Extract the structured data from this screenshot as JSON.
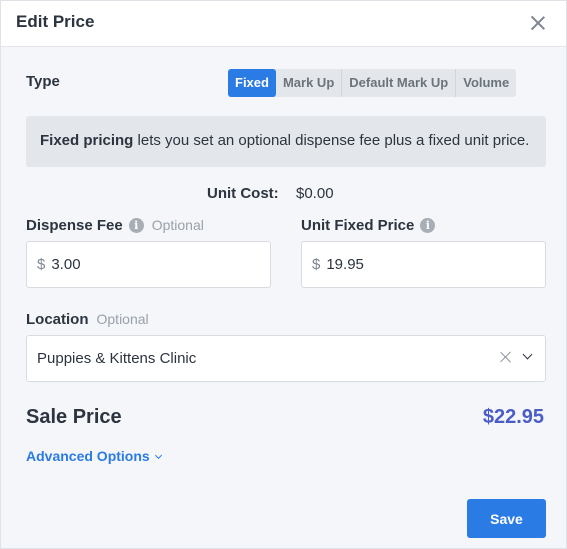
{
  "header": {
    "title": "Edit Price"
  },
  "type_field": {
    "label": "Type",
    "options": [
      "Fixed",
      "Mark Up",
      "Default Mark Up",
      "Volume"
    ],
    "selected": "Fixed"
  },
  "notice": {
    "bold": "Fixed pricing",
    "text": " lets you set an optional dispense fee plus a fixed unit price."
  },
  "unit_cost": {
    "label": "Unit Cost:",
    "value": "$0.00"
  },
  "dispense_fee": {
    "label": "Dispense Fee",
    "optional": "Optional",
    "currency": "$",
    "value": "3.00"
  },
  "unit_fixed_price": {
    "label": "Unit Fixed Price",
    "currency": "$",
    "value": "19.95"
  },
  "location": {
    "label": "Location",
    "optional": "Optional",
    "value": "Puppies & Kittens Clinic"
  },
  "sale_price": {
    "label": "Sale Price",
    "value": "$22.95"
  },
  "advanced_options": {
    "label": "Advanced Options"
  },
  "footer": {
    "save_label": "Save"
  },
  "colors": {
    "accent": "#2b7be5",
    "sale_price": "#4a5dc7"
  }
}
